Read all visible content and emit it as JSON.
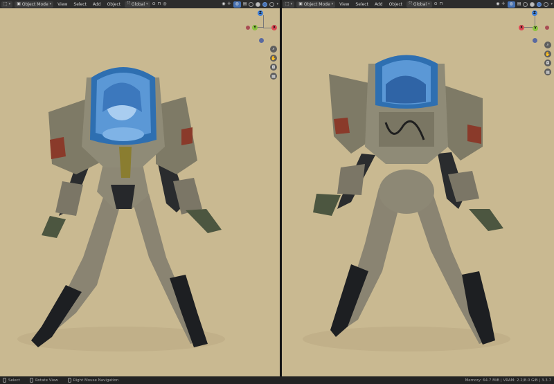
{
  "left_view": {
    "mode_label": "Object Mode",
    "menu": [
      "View",
      "Select",
      "Add",
      "Object"
    ],
    "orientation_label": "Global",
    "gizmo": {
      "z": "Z",
      "y": "Y",
      "x": "X"
    }
  },
  "right_view": {
    "mode_label": "Object Mode",
    "menu": [
      "View",
      "Select",
      "Add",
      "Object"
    ],
    "orientation_label": "Global",
    "gizmo": {
      "z": "Z",
      "y": "Y",
      "x": "X"
    }
  },
  "icons": {
    "editor_type": "viewport-icon",
    "zoom": "magnifier-icon",
    "pan": "hand-icon",
    "camera": "camera-icon",
    "grid": "grid-icon"
  },
  "statusbar": {
    "select": "Select",
    "rotate": "Rotate View",
    "navigation": "Right Mouse Navigation",
    "info": "Memory: 64.7 MiB | VRAM: 2.2/8.0 GiB | 3.3.7"
  },
  "colors": {
    "background": "#c9b991",
    "header": "#2c2c2c",
    "accent": "#4772b3",
    "axis_x": "#e04a55",
    "axis_y": "#8bc43f",
    "axis_z": "#3f7fd6"
  }
}
